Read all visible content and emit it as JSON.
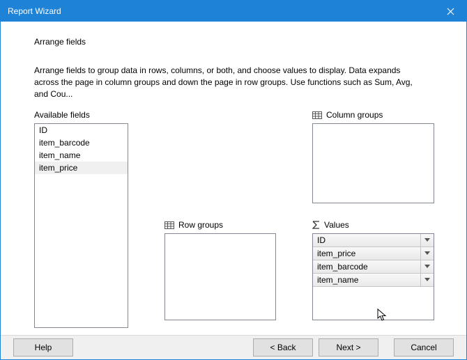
{
  "window": {
    "title": "Report Wizard"
  },
  "page": {
    "heading": "Arrange fields",
    "description": "Arrange fields to group data in rows, columns, or both, and choose values to display. Data expands across the page in column groups and down the page in row groups.  Use functions such as Sum, Avg, and Cou..."
  },
  "labels": {
    "available": "Available fields",
    "column_groups": "Column groups",
    "row_groups": "Row groups",
    "values": "Values"
  },
  "available_fields": {
    "items": [
      "ID",
      "item_barcode",
      "item_name",
      "item_price"
    ],
    "selected_index": 3
  },
  "column_groups": {
    "items": []
  },
  "row_groups": {
    "items": []
  },
  "values_list": {
    "items": [
      "ID",
      "item_price",
      "item_barcode",
      "item_name"
    ]
  },
  "buttons": {
    "help": "Help",
    "back": "< Back",
    "next": "Next >",
    "cancel": "Cancel"
  }
}
